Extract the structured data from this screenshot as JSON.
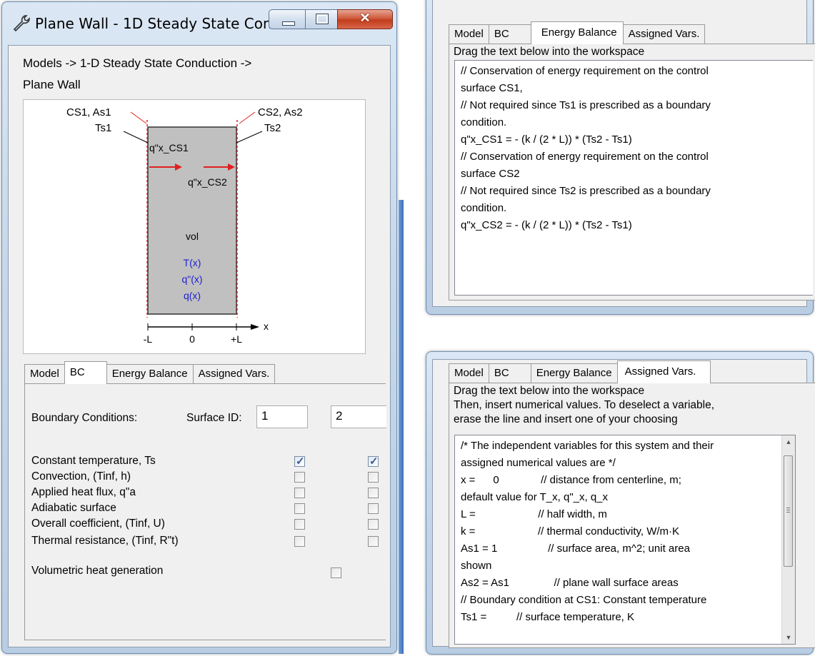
{
  "colors": {
    "accent_red": "#e02020",
    "blue_text": "#2020d0",
    "wall_fill": "#c0c0c0"
  },
  "main_window": {
    "title": "Plane Wall - 1D Steady State Con...",
    "app_icon": "wrench-icon",
    "breadcrumb_line1": "Models ->   1-D Steady State Conduction ->",
    "breadcrumb_line2": "Plane Wall",
    "diagram": {
      "cs1_label": "CS1, As1",
      "cs2_label": "CS2, As2",
      "ts1_label": "Ts1",
      "ts2_label": "Ts2",
      "q_cs1": "q\"x_CS1",
      "q_cs2": "q\"x_CS2",
      "vol": "vol",
      "t_x": "T(x)",
      "qpp_x": "q\"(x)",
      "q_x": "q(x)",
      "axis_x": "x",
      "tick_left": "-L",
      "tick_mid": "0",
      "tick_right": "+L"
    },
    "tabs": [
      "Model",
      "BC",
      "Energy Balance",
      "Assigned Vars."
    ],
    "active_tab": "BC",
    "bc": {
      "header_label": "Boundary Conditions:",
      "surface_id_label": "Surface ID:",
      "surface1": "1",
      "surface2": "2",
      "rows": [
        {
          "label": "Constant temperature, Ts",
          "s1": true,
          "s2": true
        },
        {
          "label": "Convection, (Tinf, h)",
          "s1": false,
          "s2": false
        },
        {
          "label": "Applied heat flux, q\"a",
          "s1": false,
          "s2": false
        },
        {
          "label": "Adiabatic surface",
          "s1": false,
          "s2": false
        },
        {
          "label": "Overall coefficient, (Tinf, U)",
          "s1": false,
          "s2": false
        },
        {
          "label": "Thermal resistance, (Tinf, R\"t)",
          "s1": false,
          "s2": false
        }
      ],
      "volumetric_label": "Volumetric heat generation",
      "volumetric_checked": false
    }
  },
  "energy_window": {
    "tabs": [
      "Model",
      "BC",
      "Energy Balance",
      "Assigned Vars."
    ],
    "active_tab": "Energy Balance",
    "instruction": "Drag the text below into the workspace",
    "lines": [
      "// Conservation of energy requirement on the control",
      "surface CS1,",
      "// Not required since Ts1 is prescribed as a boundary",
      "condition.",
      "q\"x_CS1 = - (k / (2 * L)) * (Ts2 - Ts1)",
      "",
      "// Conservation of energy requirement on the control",
      "surface CS2",
      "// Not required since Ts2 is prescribed as a boundary",
      "condition.",
      "q\"x_CS2 = - (k / (2 * L)) * (Ts2 - Ts1)"
    ]
  },
  "vars_window": {
    "tabs": [
      "Model",
      "BC",
      "Energy Balance",
      "Assigned Vars."
    ],
    "active_tab": "Assigned Vars.",
    "instruction1": "Drag the text below into the workspace",
    "instruction2": "Then, insert numerical values. To deselect a variable,",
    "instruction3": "erase the line and insert one of your choosing",
    "lines": [
      "/* The independent variables for this system and their",
      "assigned numerical values are */",
      "x =      0              // distance from centerline, m;",
      "default value for T_x, q\"_x, q_x",
      "L =                     // half width, m",
      "k =                     // thermal conductivity, W/m·K",
      "As1 = 1                 // surface area, m^2; unit area",
      "shown",
      "As2 = As1               // plane wall surface areas",
      "",
      "// Boundary condition at CS1: Constant temperature",
      "Ts1 =          // surface temperature, K"
    ]
  }
}
